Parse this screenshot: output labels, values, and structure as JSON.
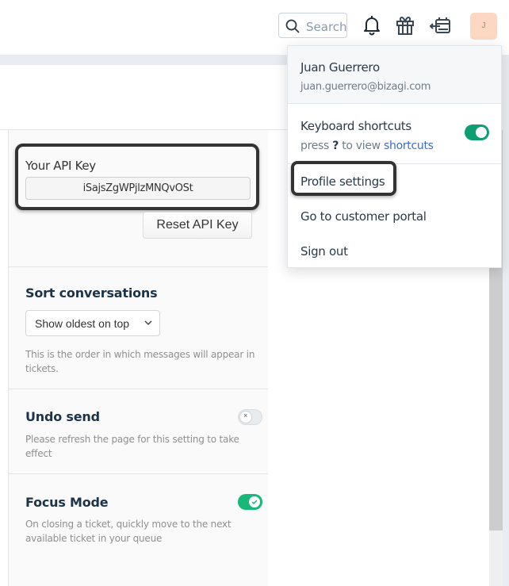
{
  "header": {
    "search_placeholder": "Search",
    "icons": [
      "search-icon",
      "bell-icon",
      "gift-icon",
      "calendar-switch-icon"
    ],
    "avatar_initial": "J",
    "avatar_color": "#fcd8c3"
  },
  "api": {
    "label": "Your API Key",
    "key": "iSajsZgWPjlzMNQvOSt",
    "reset_label": "Reset API Key"
  },
  "sort": {
    "title": "Sort conversations",
    "selected": "Show oldest on top",
    "description": "This is the order in which messages will appear in tickets."
  },
  "undo": {
    "title": "Undo send",
    "enabled": false,
    "description": "Please refresh the page for this setting to take effect"
  },
  "focus": {
    "title": "Focus Mode",
    "enabled": true,
    "description": "On closing a ticket, quickly move to the next available ticket in your queue"
  },
  "menu": {
    "user_name": "Juan Guerrero",
    "user_email": "juan.guerrero@bizagi.com",
    "keyboard_shortcuts": {
      "label": "Keyboard shortcuts",
      "press": "press",
      "key": "?",
      "to_view": "to view",
      "link": "shortcuts",
      "enabled": true
    },
    "items": [
      {
        "label": "Profile settings"
      },
      {
        "label": "Go to customer portal"
      },
      {
        "label": "Sign out"
      }
    ]
  },
  "colors": {
    "toggle_on": "#0f9d73",
    "focus_toggle_on": "#16b97a",
    "link": "#3c6bd1"
  }
}
